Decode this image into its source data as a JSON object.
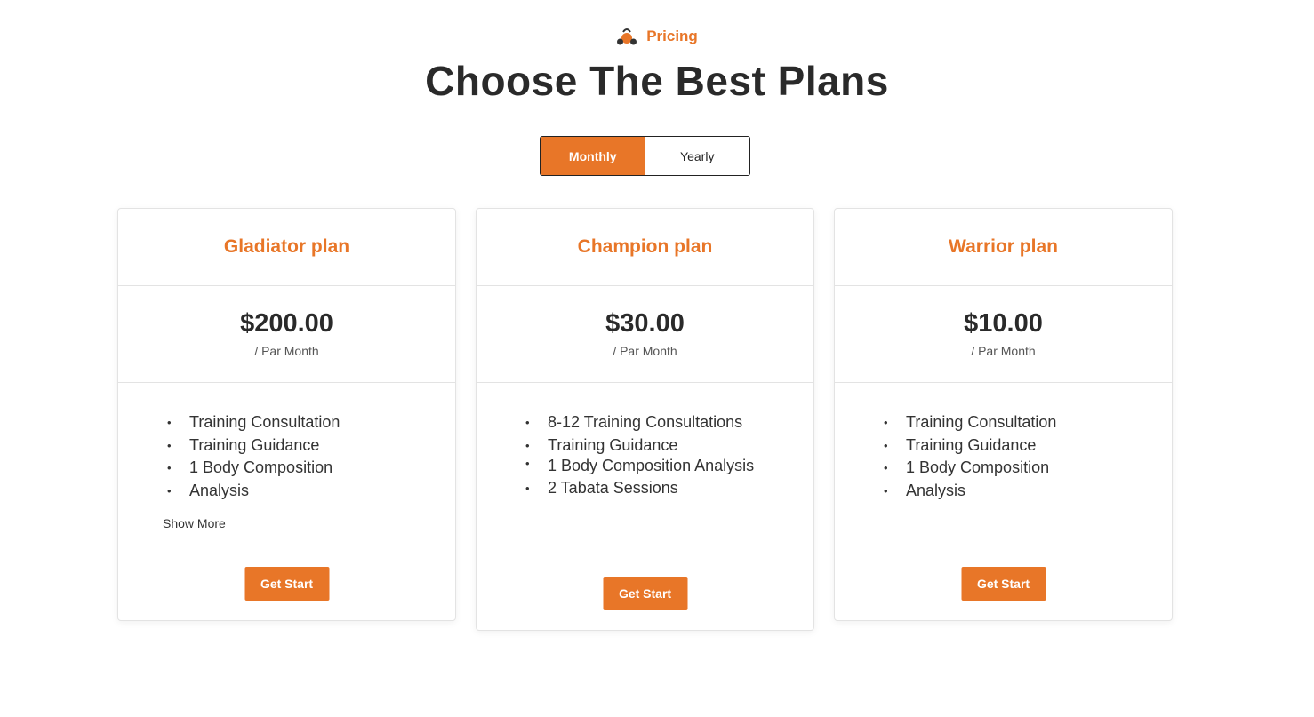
{
  "header": {
    "eyebrow_icon": "kettlebell-icon",
    "eyebrow": "Pricing",
    "title": "Choose The Best Plans"
  },
  "billing_toggle": {
    "options": [
      "Monthly",
      "Yearly"
    ],
    "selected": "Monthly"
  },
  "colors": {
    "accent": "#e87628",
    "text": "#2a2a2a",
    "border": "#e3e3e3"
  },
  "plans": [
    {
      "name": "Gladiator plan",
      "price": "$200.00",
      "period": "/ Par Month",
      "features": [
        "Training Consultation",
        "Training Guidance",
        "1 Body Composition",
        "Analysis"
      ],
      "show_more": "Show More",
      "cta": "Get Start"
    },
    {
      "name": "Champion plan",
      "price": "$30.00",
      "period": "/ Par Month",
      "features": [
        "8-12 Training Consultations",
        "Training Guidance",
        "1 Body Composition Analysis",
        "2 Tabata Sessions"
      ],
      "cta": "Get Start"
    },
    {
      "name": "Warrior plan",
      "price": "$10.00",
      "period": "/ Par Month",
      "features": [
        "Training Consultation",
        "Training Guidance",
        "1 Body Composition",
        "Analysis"
      ],
      "cta": "Get Start"
    }
  ]
}
